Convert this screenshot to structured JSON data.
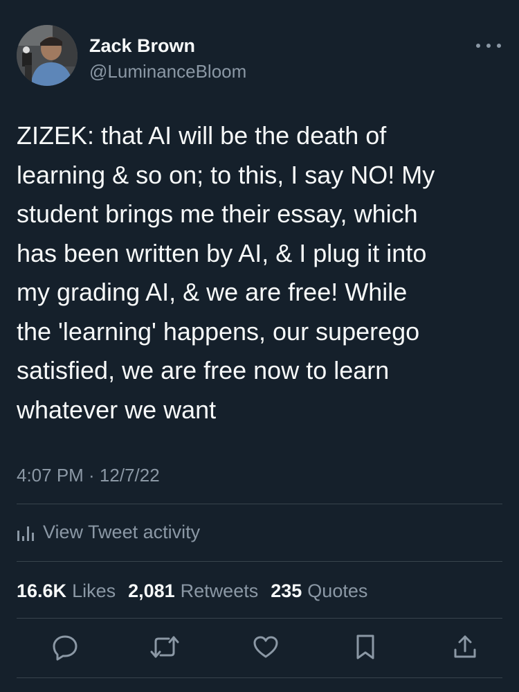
{
  "author": {
    "name": "Zack Brown",
    "handle": "@LuminanceBloom"
  },
  "tweet": {
    "text": "ZIZEK: that AI will be the death of\nlearning & so on; to this, I say NO! My\nstudent brings me their essay, which\nhas been written by AI, & I plug it into\nmy grading AI, & we are free! While\nthe 'learning' happens, our superego\nsatisfied, we are free now to learn\nwhatever we want",
    "timestamp": "4:07 PM · 12/7/22"
  },
  "activity": {
    "label": "View Tweet activity"
  },
  "stats": {
    "likes_count": "16.6K",
    "likes_label": "Likes",
    "retweets_count": "2,081",
    "retweets_label": "Retweets",
    "quotes_count": "235",
    "quotes_label": "Quotes"
  },
  "icons": {
    "reply": "reply-icon",
    "retweet": "retweet-icon",
    "like": "heart-icon",
    "bookmark": "bookmark-icon",
    "share": "share-icon",
    "more": "more-icon",
    "activity": "bar-chart-icon"
  },
  "colors": {
    "background": "#15202b",
    "text_primary": "#f7f9f9",
    "text_secondary": "#8b98a5",
    "divider": "#38444d"
  }
}
